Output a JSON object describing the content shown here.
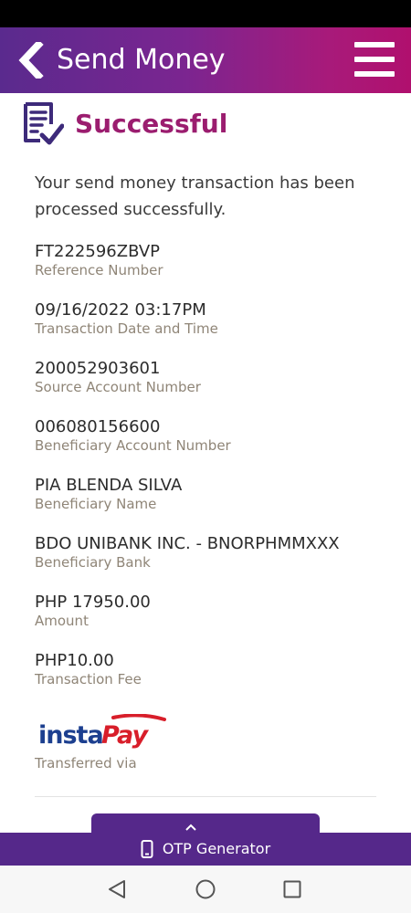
{
  "app_bar": {
    "title": "Send Money",
    "back_icon": "chevron-left-icon",
    "menu_icon": "hamburger-menu-icon",
    "gradient_colors": [
      "#5a2a8e",
      "#b0106e"
    ]
  },
  "result": {
    "icon": "document-check-icon",
    "title": "Successful",
    "title_color": "#9b1d6f",
    "message": "Your send money transaction has been processed successfully."
  },
  "details": [
    {
      "value": "FT222596ZBVP",
      "label": "Reference Number"
    },
    {
      "value": "09/16/2022 03:17PM",
      "label": "Transaction Date and Time"
    },
    {
      "value": "200052903601",
      "label": "Source Account Number"
    },
    {
      "value": "006080156600",
      "label": "Beneficiary Account Number"
    },
    {
      "value": "PIA BLENDA SILVA",
      "label": "Beneficiary Name"
    },
    {
      "value": "BDO UNIBANK INC. - BNORPHMMXXX",
      "label": "Beneficiary Bank"
    },
    {
      "value": "PHP 17950.00",
      "label": "Amount"
    },
    {
      "value": "PHP10.00",
      "label": "Transaction Fee"
    }
  ],
  "transfer": {
    "logo_text": "instaPay",
    "logo_icon": "instapay-logo",
    "label": "Transferred via"
  },
  "otp": {
    "label": "OTP Generator",
    "icon": "phone-icon",
    "tab_icon": "chevron-up-icon",
    "color": "#55288a"
  },
  "nav": {
    "back_icon": "triangle-back-icon",
    "home_icon": "circle-home-icon",
    "recents_icon": "square-recents-icon"
  }
}
